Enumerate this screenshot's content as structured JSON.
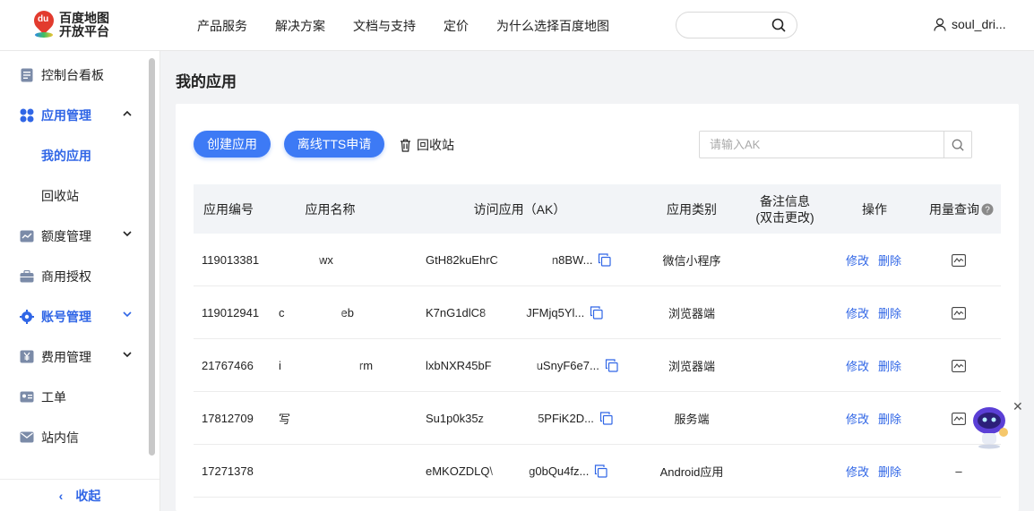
{
  "header": {
    "logo_line1": "百度地图",
    "logo_line2": "开放平台",
    "logo_badge": "du",
    "nav": [
      "产品服务",
      "解决方案",
      "文档与支持",
      "定价",
      "为什么选择百度地图"
    ],
    "user_name": "soul_dri..."
  },
  "sidebar": {
    "items": [
      {
        "label": "控制台看板",
        "icon": "dashboard-icon"
      },
      {
        "label": "应用管理",
        "icon": "apps-icon"
      },
      {
        "label": "我的应用"
      },
      {
        "label": "回收站"
      },
      {
        "label": "额度管理",
        "icon": "chart-icon"
      },
      {
        "label": "商用授权",
        "icon": "briefcase-icon"
      },
      {
        "label": "账号管理",
        "icon": "gear-icon"
      },
      {
        "label": "费用管理",
        "icon": "yen-icon"
      },
      {
        "label": "工单",
        "icon": "id-card-icon"
      },
      {
        "label": "站内信",
        "icon": "mail-icon"
      }
    ],
    "collapse_label": "收起",
    "collapse_arrow": "‹"
  },
  "main": {
    "title": "我的应用",
    "create_button": "创建应用",
    "tts_button": "离线TTS申请",
    "recycle_label": "回收站",
    "ak_placeholder": "请输入AK"
  },
  "table": {
    "headers": {
      "id": "应用编号",
      "name": "应用名称",
      "ak": "访问应用（AK）",
      "type": "应用类别",
      "note_line1": "备注信息",
      "note_line2": "(双击更改)",
      "ops": "操作",
      "usage": "用量查询"
    },
    "edit_label": "修改",
    "delete_label": "删除",
    "rows": [
      {
        "id": "119013381",
        "name_tail": "wx",
        "ak_head": "GtH82kuEhrC",
        "ak_tail": "n8BW...",
        "type": "微信小程序",
        "usage": "chart"
      },
      {
        "id": "119012941",
        "name_head": "c",
        "name_tail": "eb",
        "ak_head": "K7nG1dlC8",
        "ak_tail": "JFMjq5Yl...",
        "type": "浏览器端",
        "usage": "chart"
      },
      {
        "id": "21767466",
        "name_head": "i",
        "name_tail": "rm",
        "ak_head": "lxbNXR45bF",
        "ak_tail": "uSnyF6e7...",
        "type": "浏览器端",
        "usage": "chart"
      },
      {
        "id": "17812709",
        "name_head": "写",
        "name_tail": "",
        "ak_head": "Su1p0k35z",
        "ak_tail": "5PFiK2D...",
        "type": "服务端",
        "usage": "chart"
      },
      {
        "id": "17271378",
        "name_head": "",
        "name_tail": "",
        "ak_head": "eMKOZDLQ\\",
        "ak_tail": "g0bQu4fz...",
        "type": "Android应用",
        "usage": "–"
      }
    ]
  },
  "colors": {
    "accent": "#3d7af5",
    "link": "#3066e6"
  }
}
